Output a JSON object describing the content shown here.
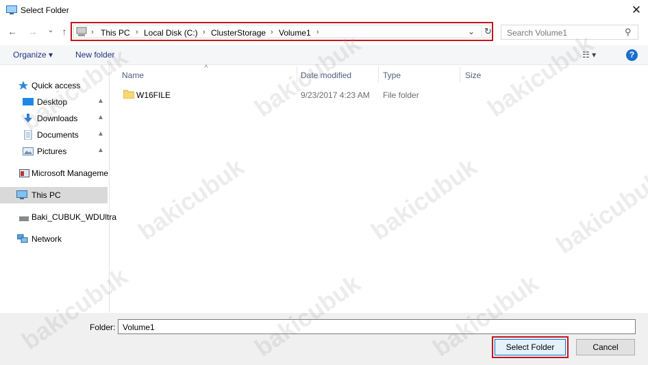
{
  "window": {
    "title": "Select Folder",
    "close_glyph": "✕"
  },
  "nav": {
    "back_glyph": "←",
    "forward_glyph": "→",
    "recent_glyph": "⌄",
    "up_glyph": "↑",
    "breadcrumb": [
      "This PC",
      "Local Disk (C:)",
      "ClusterStorage",
      "Volume1"
    ],
    "crumb_sep": "›",
    "dropdown_glyph": "⌄",
    "refresh_glyph": "↻"
  },
  "search": {
    "placeholder": "Search Volume1",
    "icon_glyph": "⚲"
  },
  "toolbar": {
    "organize_label": "Organize ▾",
    "new_folder_label": "New folder",
    "view_glyph": "☷ ▾",
    "help_glyph": "?"
  },
  "sidebar": {
    "quick_access": "Quick access",
    "items": [
      {
        "label": "Desktop",
        "pinned": true
      },
      {
        "label": "Downloads",
        "pinned": true
      },
      {
        "label": "Documents",
        "pinned": true
      },
      {
        "label": "Pictures",
        "pinned": true
      }
    ],
    "pin_glyph": "📌",
    "microsoft": "Microsoft Manageme",
    "this_pc": "This PC",
    "drive": "Baki_CUBUK_WDUltra",
    "network": "Network"
  },
  "columns": {
    "name": "Name",
    "date": "Date modified",
    "type": "Type",
    "size": "Size",
    "sort_glyph": "˄"
  },
  "files": [
    {
      "name": "W16FILE",
      "date": "9/23/2017 4:23 AM",
      "type": "File folder",
      "size": ""
    }
  ],
  "footer": {
    "folder_label": "Folder:",
    "folder_value": "Volume1",
    "select_label": "Select Folder",
    "cancel_label": "Cancel"
  },
  "watermark": "bakicubuk",
  "colors": {
    "highlight_border": "#c4141b",
    "link_blue": "#1e3287",
    "selection": "#d9d9d9"
  }
}
